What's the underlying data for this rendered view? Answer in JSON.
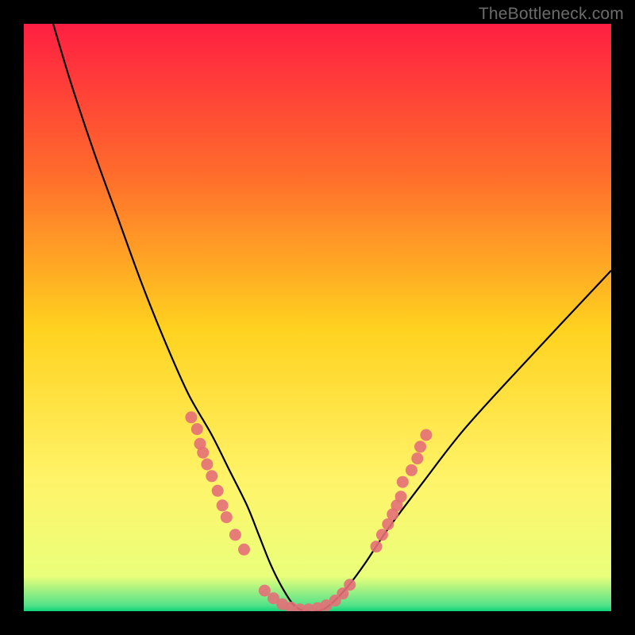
{
  "watermark": "TheBottleneck.com",
  "chart_data": {
    "type": "line",
    "title": "",
    "xlabel": "",
    "ylabel": "",
    "xlim": [
      0,
      100
    ],
    "ylim": [
      0,
      100
    ],
    "grid": false,
    "legend": false,
    "gradient_stops": [
      {
        "offset": 0,
        "color": "#ff1f42"
      },
      {
        "offset": 25,
        "color": "#ff6a2c"
      },
      {
        "offset": 52,
        "color": "#ffd21f"
      },
      {
        "offset": 78,
        "color": "#fff46a"
      },
      {
        "offset": 94,
        "color": "#eaff7a"
      },
      {
        "offset": 99,
        "color": "#53e28a"
      },
      {
        "offset": 100,
        "color": "#11d477"
      }
    ],
    "series": [
      {
        "name": "bottleneck-curve",
        "color": "#000000",
        "x": [
          5,
          8,
          12,
          16,
          20,
          24,
          28,
          32,
          35,
          38,
          40,
          42,
          44,
          46,
          48,
          50,
          52,
          55,
          58,
          62,
          68,
          75,
          85,
          100
        ],
        "y": [
          100,
          90,
          78,
          67,
          56,
          46,
          37,
          30,
          24,
          18,
          13,
          8,
          4,
          1,
          0,
          0,
          1,
          4,
          8,
          14,
          22,
          31,
          42,
          58
        ]
      }
    ],
    "dot_clusters": [
      {
        "name": "left-cluster",
        "color": "#e46f78",
        "points": [
          {
            "x": 28.5,
            "y": 33
          },
          {
            "x": 29.5,
            "y": 31
          },
          {
            "x": 30,
            "y": 28.5
          },
          {
            "x": 30.5,
            "y": 27
          },
          {
            "x": 31.2,
            "y": 25
          },
          {
            "x": 32,
            "y": 23
          },
          {
            "x": 33,
            "y": 20.5
          },
          {
            "x": 33.8,
            "y": 18
          },
          {
            "x": 34.5,
            "y": 16
          },
          {
            "x": 36,
            "y": 13
          },
          {
            "x": 37.5,
            "y": 10.5
          }
        ]
      },
      {
        "name": "bottom-cluster",
        "color": "#e46f78",
        "points": [
          {
            "x": 41,
            "y": 3.5
          },
          {
            "x": 42.5,
            "y": 2.2
          },
          {
            "x": 44,
            "y": 1.2
          },
          {
            "x": 45.5,
            "y": 0.6
          },
          {
            "x": 47,
            "y": 0.3
          },
          {
            "x": 48.5,
            "y": 0.3
          },
          {
            "x": 50,
            "y": 0.5
          },
          {
            "x": 51.5,
            "y": 1
          },
          {
            "x": 53,
            "y": 1.8
          },
          {
            "x": 54.3,
            "y": 3
          },
          {
            "x": 55.5,
            "y": 4.5
          }
        ]
      },
      {
        "name": "right-cluster",
        "color": "#e46f78",
        "points": [
          {
            "x": 60,
            "y": 11
          },
          {
            "x": 61,
            "y": 13
          },
          {
            "x": 62,
            "y": 14.8
          },
          {
            "x": 62.8,
            "y": 16.5
          },
          {
            "x": 63.5,
            "y": 18
          },
          {
            "x": 64.2,
            "y": 19.5
          },
          {
            "x": 64.5,
            "y": 22
          },
          {
            "x": 66,
            "y": 24
          },
          {
            "x": 67,
            "y": 26
          },
          {
            "x": 67.5,
            "y": 28
          },
          {
            "x": 68.5,
            "y": 30
          }
        ]
      }
    ]
  }
}
